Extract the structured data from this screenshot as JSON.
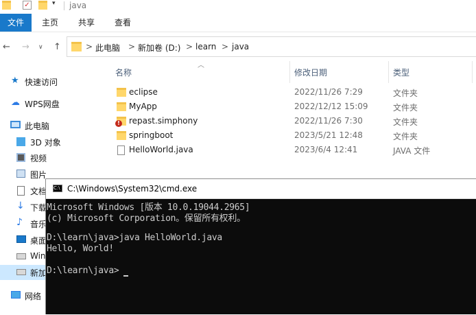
{
  "window": {
    "title": "java"
  },
  "ribbon": {
    "tabs": [
      "文件",
      "主页",
      "共享",
      "查看"
    ]
  },
  "address": {
    "crumbs": [
      "此电脑",
      "新加卷 (D:)",
      "learn",
      "java"
    ],
    "separator": ">"
  },
  "sidebar": {
    "items": [
      {
        "label": "快速访问",
        "icon": "pin-star-icon"
      },
      {
        "label": "WPS网盘",
        "icon": "cloud-icon"
      },
      {
        "label": "此电脑",
        "icon": "computer-icon"
      },
      {
        "label": "3D 对象",
        "icon": "cube-icon"
      },
      {
        "label": "视频",
        "icon": "video-icon"
      },
      {
        "label": "图片",
        "icon": "picture-icon"
      },
      {
        "label": "文档",
        "icon": "document-icon"
      },
      {
        "label": "下载",
        "icon": "download-icon"
      },
      {
        "label": "音乐",
        "icon": "music-icon"
      },
      {
        "label": "桌面",
        "icon": "desktop-icon"
      },
      {
        "label": "Win",
        "icon": "drive-icon"
      },
      {
        "label": "新加",
        "icon": "drive-icon"
      },
      {
        "label": "网络",
        "icon": "network-icon"
      }
    ]
  },
  "columns": {
    "name": "名称",
    "date": "修改日期",
    "type": "类型"
  },
  "files": [
    {
      "name": "eclipse",
      "date": "2022/11/26 7:29",
      "type": "文件夹",
      "icon": "folder-icon"
    },
    {
      "name": "MyApp",
      "date": "2022/12/12 15:09",
      "type": "文件夹",
      "icon": "folder-icon"
    },
    {
      "name": "repast.simphony",
      "date": "2022/11/26 7:30",
      "type": "文件夹",
      "icon": "folder-error-icon"
    },
    {
      "name": "springboot",
      "date": "2023/5/21 12:48",
      "type": "文件夹",
      "icon": "folder-icon"
    },
    {
      "name": "HelloWorld.java",
      "date": "2023/6/4 12:41",
      "type": "JAVA 文件",
      "icon": "file-icon"
    }
  ],
  "cmd": {
    "title": "C:\\Windows\\System32\\cmd.exe",
    "lines": [
      "Microsoft Windows [版本 10.0.19044.2965]",
      "(c) Microsoft Corporation。保留所有权利。",
      "",
      "D:\\learn\\java>java HelloWorld.java",
      "Hello, World!",
      "",
      "D:\\learn\\java>"
    ]
  },
  "colors": {
    "accent": "#1979ca",
    "folder": "#ffd76b",
    "cmd_bg": "#0c0c0c",
    "cmd_text": "#cccccc"
  }
}
